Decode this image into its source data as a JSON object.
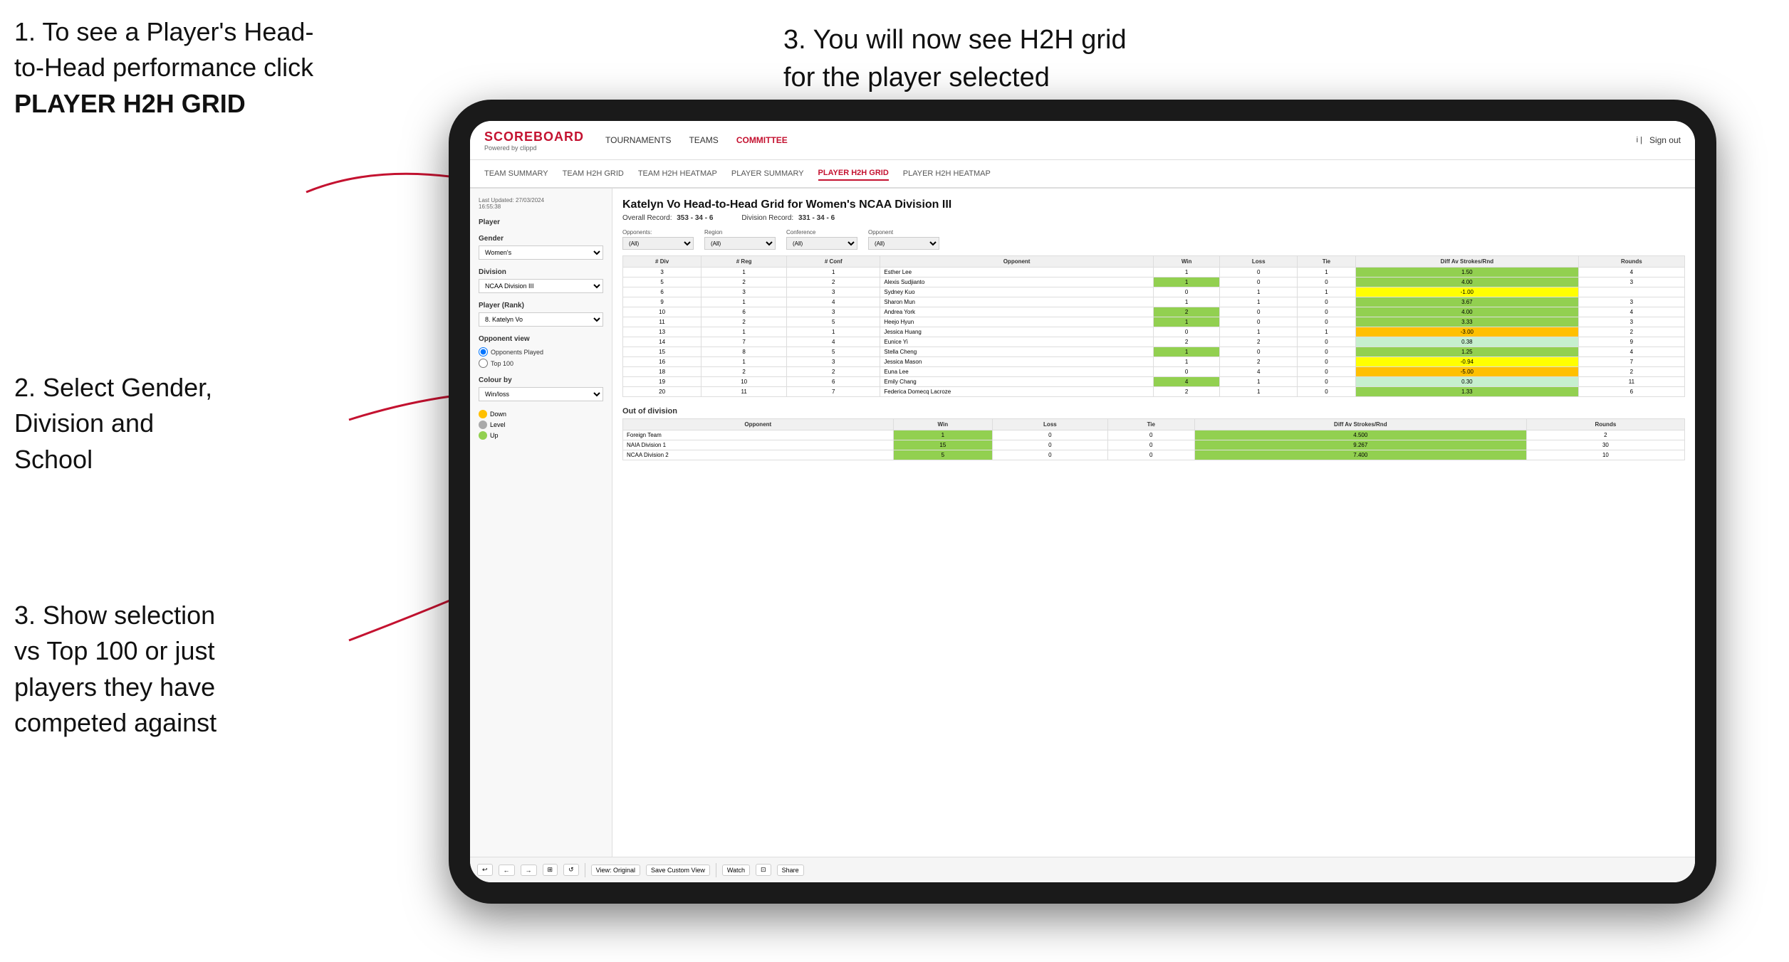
{
  "instructions": {
    "step1_line1": "1. To see a Player's Head-",
    "step1_line2": "to-Head performance click",
    "step1_bold": "PLAYER H2H GRID",
    "step2_line1": "2. Select Gender,",
    "step2_line2": "Division and",
    "step2_line3": "School",
    "step3_top_line1": "3. You will now see H2H grid",
    "step3_top_line2": "for the player selected",
    "step3_bottom_line1": "3. Show selection",
    "step3_bottom_line2": "vs Top 100 or just",
    "step3_bottom_line3": "players they have",
    "step3_bottom_line4": "competed against"
  },
  "nav": {
    "logo": "SCOREBOARD",
    "logo_sub": "Powered by clippd",
    "links": [
      "TOURNAMENTS",
      "TEAMS",
      "COMMITTEE"
    ],
    "active_link": "COMMITTEE",
    "sign_out": "Sign out"
  },
  "sub_nav": {
    "links": [
      "TEAM SUMMARY",
      "TEAM H2H GRID",
      "TEAM H2H HEATMAP",
      "PLAYER SUMMARY",
      "PLAYER H2H GRID",
      "PLAYER H2H HEATMAP"
    ],
    "active": "PLAYER H2H GRID"
  },
  "sidebar": {
    "timestamp": "Last Updated: 27/03/2024",
    "timestamp2": "16:55:38",
    "player_label": "Player",
    "gender_label": "Gender",
    "gender_value": "Women's",
    "division_label": "Division",
    "division_value": "NCAA Division III",
    "player_rank_label": "Player (Rank)",
    "player_rank_value": "8. Katelyn Vo",
    "opponent_view_label": "Opponent view",
    "radio1": "Opponents Played",
    "radio2": "Top 100",
    "colour_by_label": "Colour by",
    "colour_by_value": "Win/loss",
    "legend_down": "Down",
    "legend_level": "Level",
    "legend_up": "Up"
  },
  "content": {
    "title": "Katelyn Vo Head-to-Head Grid for Women's NCAA Division III",
    "overall_record_label": "Overall Record:",
    "overall_record": "353 - 34 - 6",
    "division_record_label": "Division Record:",
    "division_record": "331 - 34 - 6",
    "filter_opponents_label": "Opponents:",
    "filter_region_label": "Region",
    "filter_conference_label": "Conference",
    "filter_opponent_label": "Opponent",
    "filter_all": "(All)",
    "table_headers": [
      "# Div",
      "# Reg",
      "# Conf",
      "Opponent",
      "Win",
      "Loss",
      "Tie",
      "Diff Av Strokes/Rnd",
      "Rounds"
    ],
    "table_rows": [
      {
        "div": "3",
        "reg": "1",
        "conf": "1",
        "opponent": "Esther Lee",
        "win": "1",
        "loss": "0",
        "tie": "1",
        "diff": "1.50",
        "rounds": "4",
        "win_color": "",
        "loss_color": "",
        "diff_color": "green"
      },
      {
        "div": "5",
        "reg": "2",
        "conf": "2",
        "opponent": "Alexis Sudjianto",
        "win": "1",
        "loss": "0",
        "tie": "0",
        "diff": "4.00",
        "rounds": "3",
        "win_color": "green",
        "diff_color": "green"
      },
      {
        "div": "6",
        "reg": "3",
        "conf": "3",
        "opponent": "Sydney Kuo",
        "win": "0",
        "loss": "1",
        "tie": "1",
        "diff": "-1.00",
        "rounds": "",
        "diff_color": "yellow"
      },
      {
        "div": "9",
        "reg": "1",
        "conf": "4",
        "opponent": "Sharon Mun",
        "win": "1",
        "loss": "1",
        "tie": "0",
        "diff": "3.67",
        "rounds": "3",
        "diff_color": "green"
      },
      {
        "div": "10",
        "reg": "6",
        "conf": "3",
        "opponent": "Andrea York",
        "win": "2",
        "loss": "0",
        "tie": "0",
        "diff": "4.00",
        "rounds": "4",
        "win_color": "green",
        "diff_color": "green"
      },
      {
        "div": "11",
        "reg": "2",
        "conf": "5",
        "opponent": "Heejo Hyun",
        "win": "1",
        "loss": "0",
        "tie": "0",
        "diff": "3.33",
        "rounds": "3",
        "win_color": "green",
        "diff_color": "green"
      },
      {
        "div": "13",
        "reg": "1",
        "conf": "1",
        "opponent": "Jessica Huang",
        "win": "0",
        "loss": "1",
        "tie": "1",
        "diff": "-3.00",
        "rounds": "2",
        "diff_color": "orange"
      },
      {
        "div": "14",
        "reg": "7",
        "conf": "4",
        "opponent": "Eunice Yi",
        "win": "2",
        "loss": "2",
        "tie": "0",
        "diff": "0.38",
        "rounds": "9",
        "diff_color": "light-green"
      },
      {
        "div": "15",
        "reg": "8",
        "conf": "5",
        "opponent": "Stella Cheng",
        "win": "1",
        "loss": "0",
        "tie": "0",
        "diff": "1.25",
        "rounds": "4",
        "win_color": "green",
        "diff_color": "green"
      },
      {
        "div": "16",
        "reg": "1",
        "conf": "3",
        "opponent": "Jessica Mason",
        "win": "1",
        "loss": "2",
        "tie": "0",
        "diff": "-0.94",
        "rounds": "7",
        "diff_color": "yellow"
      },
      {
        "div": "18",
        "reg": "2",
        "conf": "2",
        "opponent": "Euna Lee",
        "win": "0",
        "loss": "4",
        "tie": "0",
        "diff": "-5.00",
        "rounds": "2",
        "diff_color": "orange"
      },
      {
        "div": "19",
        "reg": "10",
        "conf": "6",
        "opponent": "Emily Chang",
        "win": "4",
        "loss": "1",
        "tie": "0",
        "diff": "0.30",
        "rounds": "11",
        "win_color": "green",
        "diff_color": "light-green"
      },
      {
        "div": "20",
        "reg": "11",
        "conf": "7",
        "opponent": "Federica Domecq Lacroze",
        "win": "2",
        "loss": "1",
        "tie": "0",
        "diff": "1.33",
        "rounds": "6",
        "diff_color": "green"
      }
    ],
    "out_of_division_label": "Out of division",
    "out_of_division_rows": [
      {
        "opponent": "Foreign Team",
        "win": "1",
        "loss": "0",
        "tie": "0",
        "diff": "4.500",
        "rounds": "2"
      },
      {
        "opponent": "NAIA Division 1",
        "win": "15",
        "loss": "0",
        "tie": "0",
        "diff": "9.267",
        "rounds": "30"
      },
      {
        "opponent": "NCAA Division 2",
        "win": "5",
        "loss": "0",
        "tie": "0",
        "diff": "7.400",
        "rounds": "10"
      }
    ]
  },
  "toolbar": {
    "view_original": "View: Original",
    "save_custom_view": "Save Custom View",
    "watch": "Watch",
    "share": "Share"
  }
}
